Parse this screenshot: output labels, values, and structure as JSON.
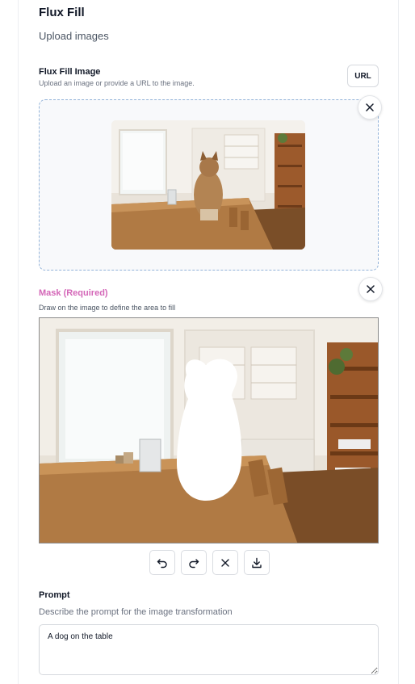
{
  "header": {
    "title": "Flux Fill",
    "subtitle": "Upload images"
  },
  "image_field": {
    "label": "Flux Fill Image",
    "help": "Upload an image or provide a URL to the image.",
    "url_button_label": "URL",
    "remove_icon": "close-icon"
  },
  "mask_field": {
    "label": "Mask (Required)",
    "help": "Draw on the image to define the area to fill",
    "remove_icon": "close-icon"
  },
  "mask_toolbar": {
    "buttons": [
      {
        "name": "undo-icon"
      },
      {
        "name": "redo-icon"
      },
      {
        "name": "close-icon"
      },
      {
        "name": "download-icon"
      }
    ]
  },
  "prompt_field": {
    "label": "Prompt",
    "help": "Describe the prompt for the image transformation",
    "value": "A dog on the table"
  },
  "colors": {
    "mask_label": "#d467b8",
    "dropzone_border": "#93b3d9",
    "dropzone_bg": "#f8f9fb",
    "wood": "#b07a44"
  }
}
